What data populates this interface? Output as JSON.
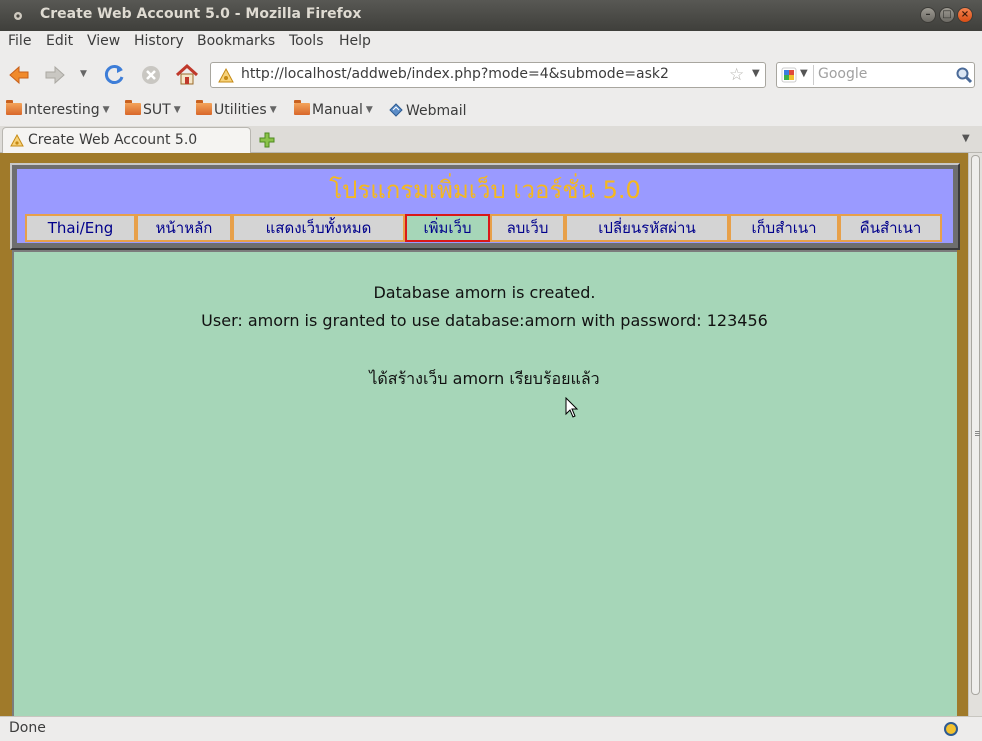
{
  "window": {
    "title": "Create Web Account 5.0 - Mozilla Firefox"
  },
  "menubar": {
    "items": [
      "File",
      "Edit",
      "View",
      "History",
      "Bookmarks",
      "Tools",
      "Help"
    ]
  },
  "navbar": {
    "url": "http://localhost/addweb/index.php?mode=4&submode=ask2",
    "search_placeholder": "Google"
  },
  "bookmarks": {
    "items": [
      "Interesting",
      "SUT",
      "Utilities",
      "Manual",
      "Webmail"
    ]
  },
  "tabs": {
    "active_label": "Create Web Account 5.0"
  },
  "page": {
    "title": "โปรแกรมเพิ่มเว็บ เวอร์ชั่น 5.0",
    "menu": [
      "Thai/Eng",
      "หน้าหลัก",
      "แสดงเว็บทั้งหมด",
      "เพิ่มเว็บ",
      "ลบเว็บ",
      "เปลี่ยนรหัสผ่าน",
      "เก็บสำเนา",
      "คืนสำเนา"
    ],
    "active_menu": "เพิ่มเว็บ",
    "messages": {
      "db_created": "Database amorn is created.",
      "user_granted": "User: amorn is granted to use database:amorn with password: 123456",
      "thai_done": "ได้สร้างเว็บ amorn เรียบร้อยแล้ว"
    }
  },
  "status": {
    "text": "Done"
  },
  "colors": {
    "header_bg": "#9a9aff",
    "title_text": "#f5b81e",
    "content_bg": "#a6d6b8",
    "outer_bg": "#a07a2a",
    "menu_border": "#e7a04a",
    "active_border": "#d91818",
    "menu_text": "#00008b"
  }
}
